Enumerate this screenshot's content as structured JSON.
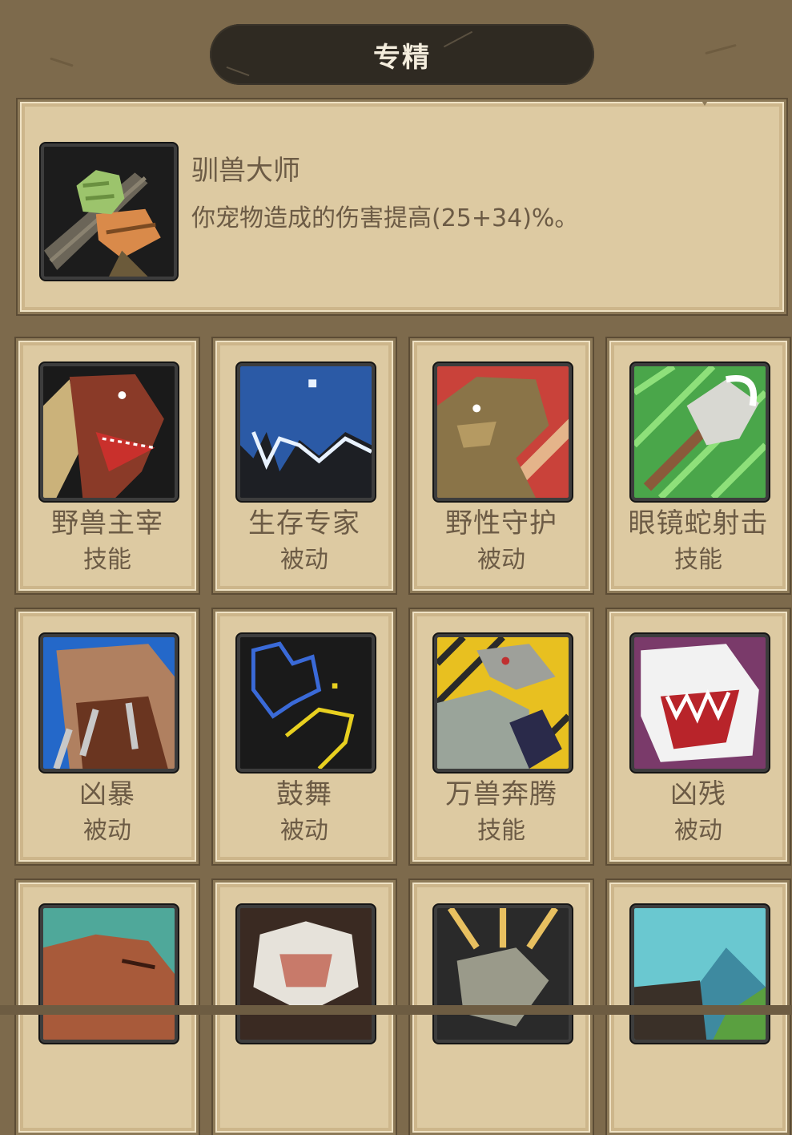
{
  "header": {
    "title": "专精"
  },
  "specialization": {
    "name": "驯兽大师",
    "description": "你宠物造成的伤害提高(25+34)%。",
    "icon": "beast-master-fist-icon"
  },
  "talents": [
    {
      "name": "野兽主宰",
      "type": "技能",
      "icon": "raptor-icon"
    },
    {
      "name": "生存专家",
      "type": "被动",
      "icon": "frost-wolf-icon"
    },
    {
      "name": "野性守护",
      "type": "被动",
      "icon": "wild-beast-icon"
    },
    {
      "name": "眼镜蛇射击",
      "type": "技能",
      "icon": "cobra-arrow-icon"
    },
    {
      "name": "凶暴",
      "type": "被动",
      "icon": "claw-icon"
    },
    {
      "name": "鼓舞",
      "type": "被动",
      "icon": "roar-silhouette-icon"
    },
    {
      "name": "万兽奔腾",
      "type": "技能",
      "icon": "stampede-icon"
    },
    {
      "name": "凶残",
      "type": "被动",
      "icon": "fangs-icon"
    },
    {
      "name": "",
      "type": "",
      "icon": "bear-icon"
    },
    {
      "name": "",
      "type": "",
      "icon": "yeti-icon"
    },
    {
      "name": "",
      "type": "",
      "icon": "dragon-icon"
    },
    {
      "name": "",
      "type": "",
      "icon": "cliff-landscape-icon"
    }
  ],
  "colors": {
    "background": "#7d6a4c",
    "panel": "#ddcaa2",
    "text": "#6c5b45",
    "header": "#2f2a22"
  }
}
